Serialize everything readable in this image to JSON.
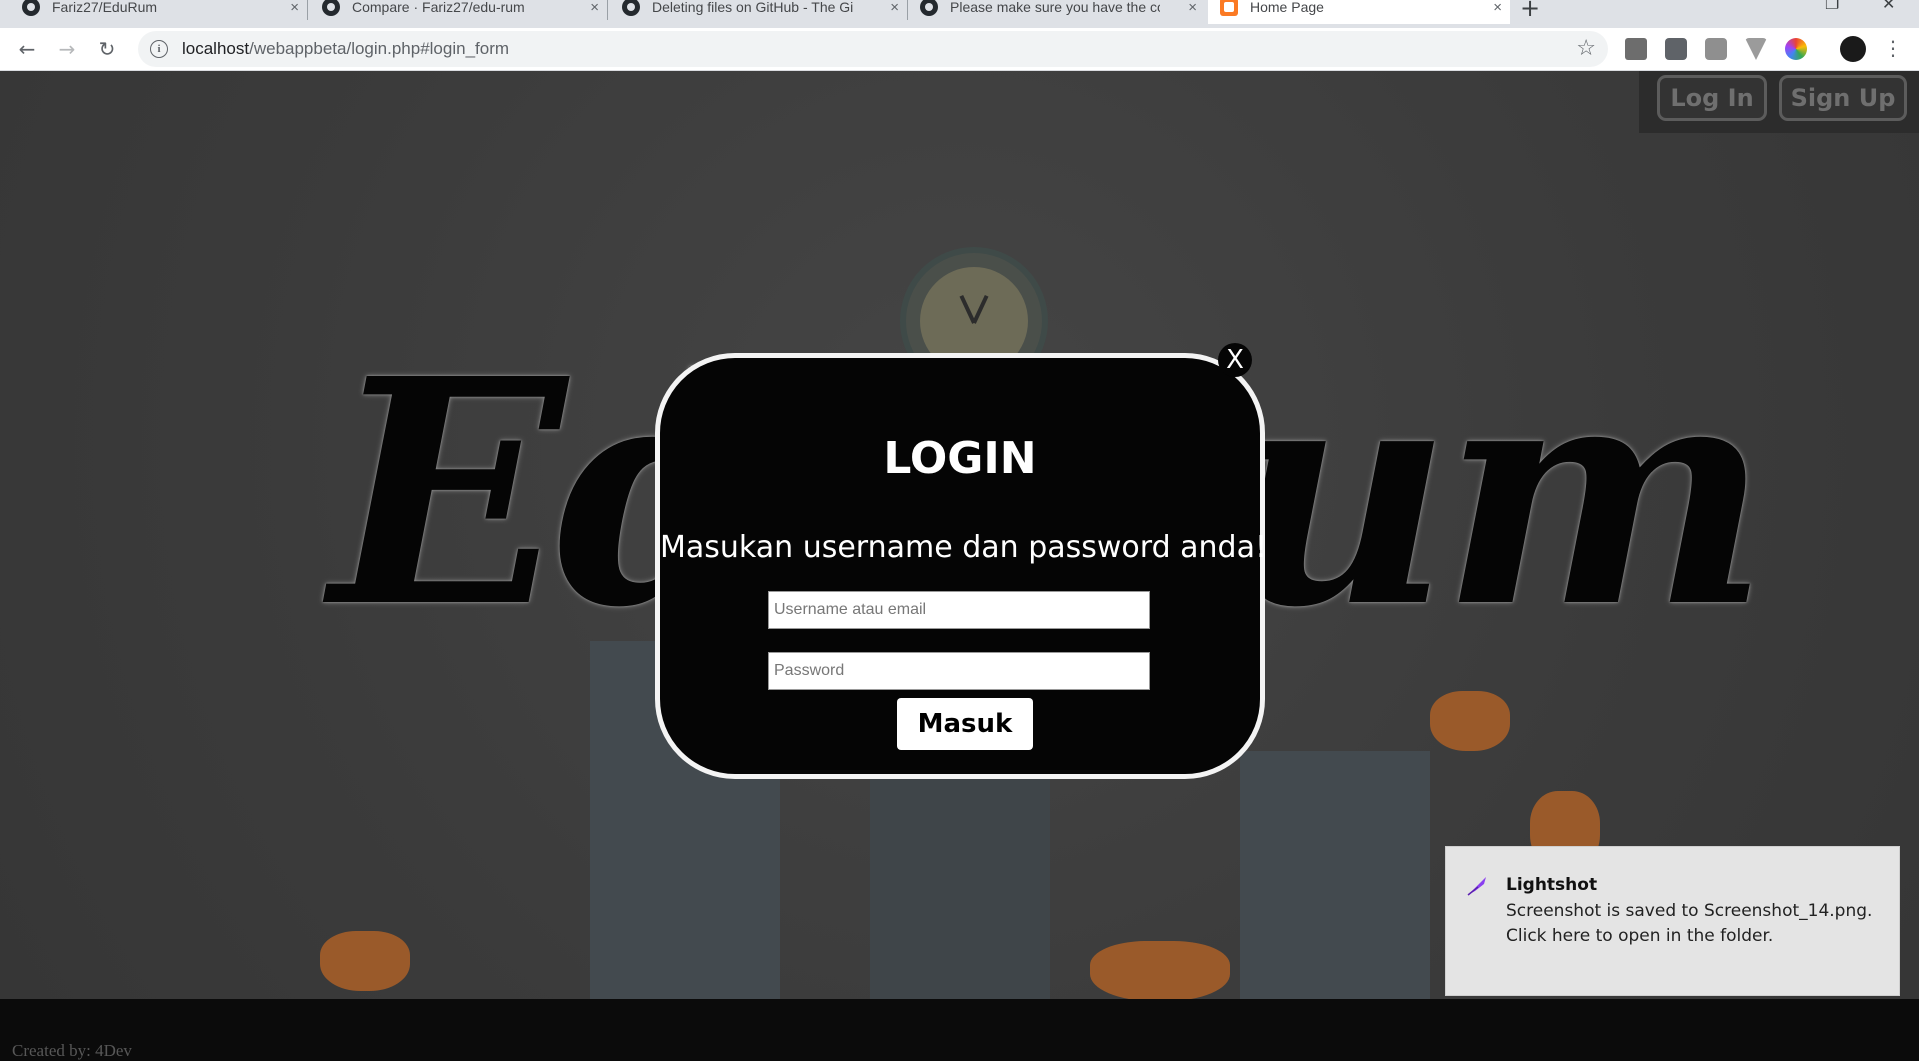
{
  "browser": {
    "tabs": [
      {
        "title": "Fariz27/EduRum",
        "active": false,
        "icon": "github-icon"
      },
      {
        "title": "Compare · Fariz27/edu-rum",
        "active": false,
        "icon": "github-icon"
      },
      {
        "title": "Deleting files on GitHub - The Gi",
        "active": false,
        "icon": "github-icon"
      },
      {
        "title": "Please make sure you have the co",
        "active": false,
        "icon": "github-icon"
      },
      {
        "title": "Home Page",
        "active": true,
        "icon": "xampp-icon"
      }
    ],
    "close_glyph": "×",
    "new_tab_glyph": "+",
    "url_host": "localhost",
    "url_path": "/webappbeta/login.php#login_form"
  },
  "page": {
    "brand": "EduRum",
    "nav": {
      "login": "Log In",
      "signup": "Sign Up"
    },
    "footer": {
      "credit": "Created by: 4Dev"
    }
  },
  "login_modal": {
    "close": "X",
    "title": "LOGIN",
    "message": "Masukan username dan password anda!",
    "username_placeholder": "Username atau email",
    "password_placeholder": "Password",
    "submit": "Masuk"
  },
  "notification": {
    "app": "Lightshot",
    "body": "Screenshot is saved to Screenshot_14.png. Click here to open in the folder.",
    "accent": "#8a3ff0"
  },
  "colors": {
    "overlay": "#3a3a3a",
    "modal_bg": "#050505",
    "modal_border": "#f4f4f4"
  }
}
